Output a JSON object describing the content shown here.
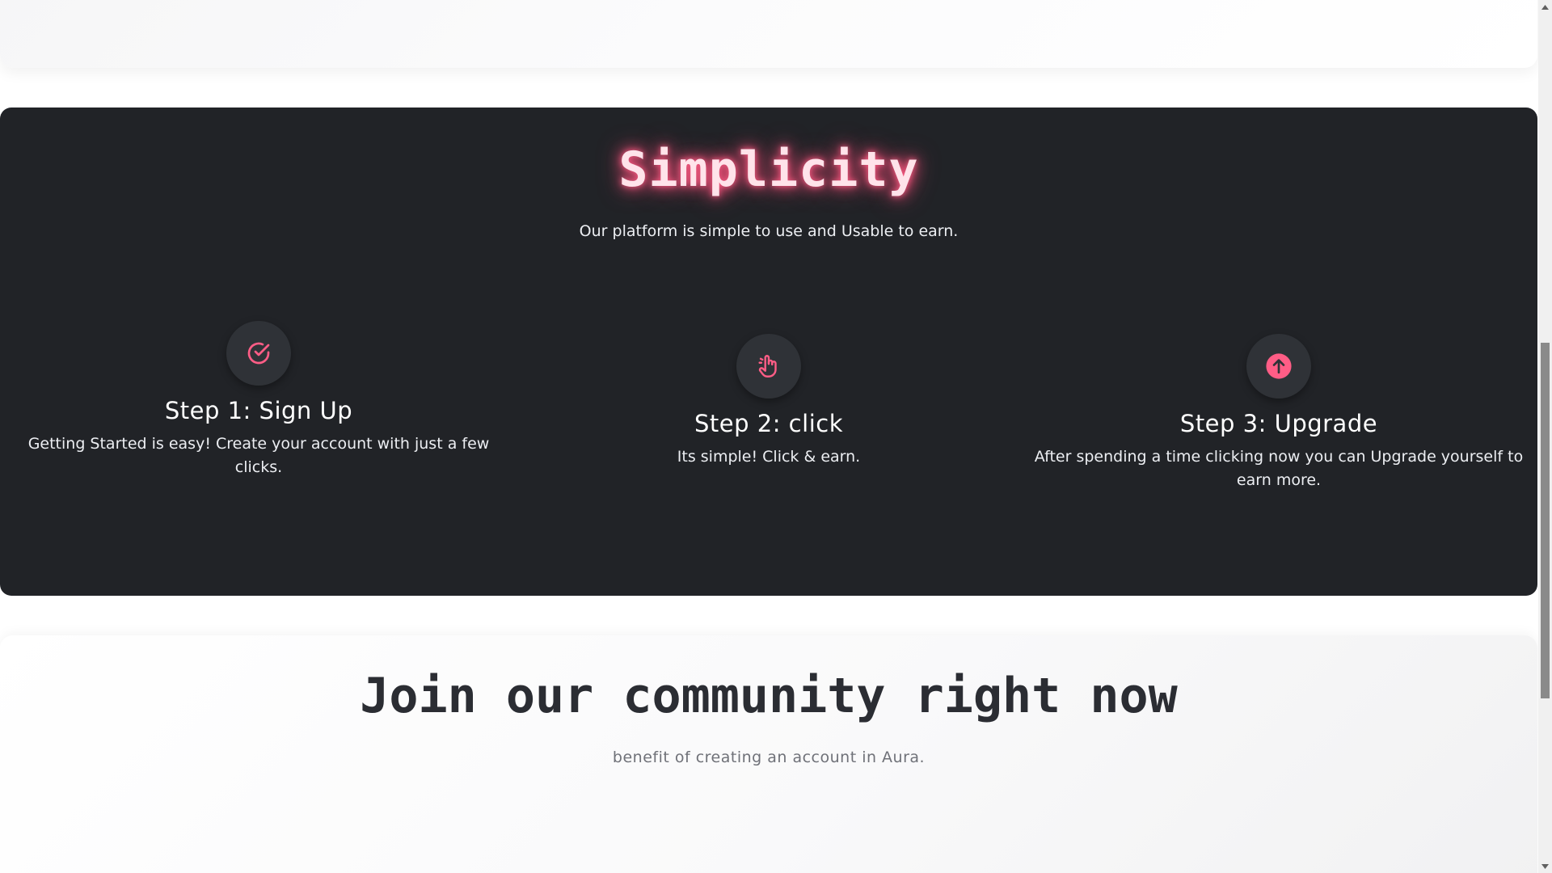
{
  "simplicity_section": {
    "title": "Simplicity",
    "subtitle": "Our platform is simple to use and Usable to earn.",
    "accent_color": "#ff5d86",
    "background_color": "#212327",
    "steps": [
      {
        "icon": "check-circle-icon",
        "title": "Step 1: Sign Up",
        "description": "Getting Started is easy! Create your account with just a few clicks."
      },
      {
        "icon": "hand-pointer-icon",
        "title": "Step 2: click",
        "description": "Its simple! Click & earn."
      },
      {
        "icon": "arrow-up-circle-icon",
        "title": "Step 3: Upgrade",
        "description": "After spending a time clicking now you can Upgrade yourself to earn more."
      }
    ]
  },
  "community_section": {
    "title": "Join our community right now",
    "subtitle": "benefit of creating an account in Aura."
  },
  "scrollbar": {
    "up_icon": "scroll-up-arrow-icon",
    "down_icon": "scroll-down-arrow-icon"
  }
}
